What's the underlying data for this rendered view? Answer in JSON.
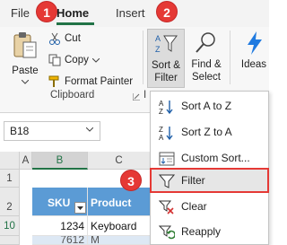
{
  "tabs": {
    "file": "File",
    "home": "Home",
    "insert": "Insert"
  },
  "badges": {
    "one": "1",
    "two": "2",
    "three": "3"
  },
  "clipboard": {
    "paste_label": "Paste",
    "cut_label": "Cut",
    "copy_label": "Copy",
    "format_painter_label": "Format Painter",
    "group_label": "Clipboard"
  },
  "editing": {
    "sort_filter_line1": "Sort &",
    "sort_filter_line2": "Filter",
    "find_select_line1": "Find &",
    "find_select_line2": "Select",
    "ideas_label": "Ideas",
    "group_label_partial": "I"
  },
  "name_box": {
    "value": "B18"
  },
  "grid": {
    "columns": [
      "A",
      "B",
      "C"
    ],
    "rows": [
      "1",
      "2",
      "10"
    ],
    "header_row": {
      "sku": "SKU",
      "product": "Product"
    },
    "data_row": {
      "sku": "1234",
      "product": "Keyboard"
    },
    "partial_row": {
      "sku": "7612",
      "product": "M"
    }
  },
  "menu": {
    "items": [
      {
        "label": "Sort A to Z",
        "icon": "sort-a-to-z-icon"
      },
      {
        "label": "Sort Z to A",
        "icon": "sort-z-to-a-icon"
      },
      {
        "label": "Custom Sort...",
        "icon": "custom-sort-icon"
      },
      {
        "label": "Filter",
        "icon": "filter-icon"
      },
      {
        "label": "Clear",
        "icon": "clear-filter-icon"
      },
      {
        "label": "Reapply",
        "icon": "reapply-icon"
      }
    ]
  },
  "colors": {
    "accent_green": "#217346",
    "badge_red": "#e53935",
    "table_header_blue": "#5b9bd5"
  }
}
